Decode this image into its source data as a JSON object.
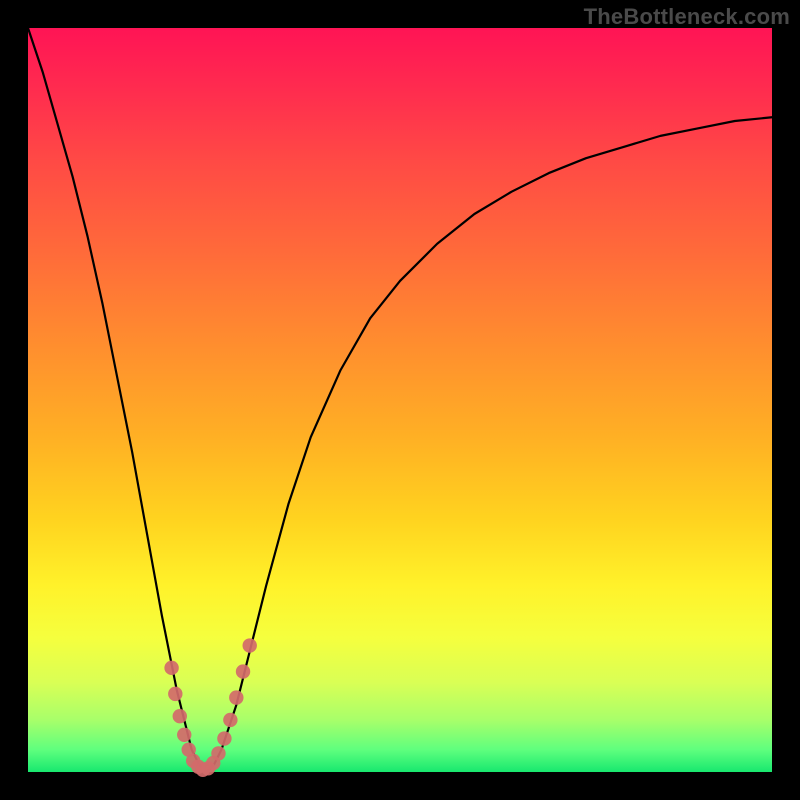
{
  "watermark": "TheBottleneck.com",
  "colors": {
    "frame": "#000000",
    "curve": "#000000",
    "marker": "#d36a6a",
    "gradient_top": "#ff1455",
    "gradient_bottom": "#18e86f"
  },
  "chart_data": {
    "type": "line",
    "title": "",
    "xlabel": "",
    "ylabel": "",
    "xlim": [
      0,
      100
    ],
    "ylim": [
      0,
      100
    ],
    "x": [
      0,
      2,
      4,
      6,
      8,
      10,
      12,
      14,
      16,
      18,
      19,
      20,
      21,
      22,
      23,
      24,
      25,
      26,
      28,
      30,
      32,
      35,
      38,
      42,
      46,
      50,
      55,
      60,
      65,
      70,
      75,
      80,
      85,
      90,
      95,
      100
    ],
    "y": [
      100,
      94,
      87,
      80,
      72,
      63,
      53,
      43,
      32,
      21,
      16,
      11,
      7,
      3,
      1,
      0,
      1,
      3,
      9,
      17,
      25,
      36,
      45,
      54,
      61,
      66,
      71,
      75,
      78,
      80.5,
      82.5,
      84,
      85.5,
      86.5,
      87.5,
      88
    ],
    "markers": {
      "x": [
        19.3,
        19.8,
        20.4,
        21.0,
        21.6,
        22.2,
        22.9,
        23.5,
        24.2,
        24.9,
        25.6,
        26.4,
        27.2,
        28.0,
        28.9,
        29.8
      ],
      "y": [
        14.0,
        10.5,
        7.5,
        5.0,
        3.0,
        1.5,
        0.7,
        0.3,
        0.5,
        1.2,
        2.5,
        4.5,
        7.0,
        10.0,
        13.5,
        17.0
      ]
    }
  }
}
